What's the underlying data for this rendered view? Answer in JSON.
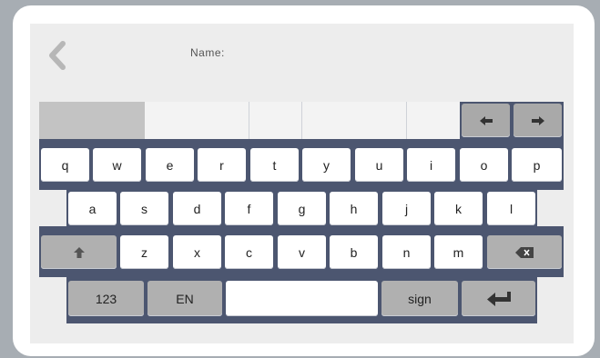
{
  "header": {
    "name_label": "Name:",
    "name_value": ""
  },
  "icons": {
    "back": "chevron-left-icon",
    "left": "arrow-left-icon",
    "right": "arrow-right-icon",
    "shift": "shift-up-icon",
    "backspace": "backspace-icon",
    "enter": "enter-icon"
  },
  "keyboard": {
    "row1": [
      "q",
      "w",
      "e",
      "r",
      "t",
      "y",
      "u",
      "i",
      "o",
      "p"
    ],
    "row2": [
      "a",
      "s",
      "d",
      "f",
      "g",
      "h",
      "j",
      "k",
      "l"
    ],
    "row3": [
      "z",
      "x",
      "c",
      "v",
      "b",
      "n",
      "m"
    ],
    "row4": {
      "numbers": "123",
      "language": "EN",
      "space": "",
      "sign": "sign"
    }
  },
  "colors": {
    "background": "#a7adb3",
    "keyboard_bg": "#4c5670",
    "key": "#ffffff",
    "key_dark": "#a9a9a9"
  }
}
